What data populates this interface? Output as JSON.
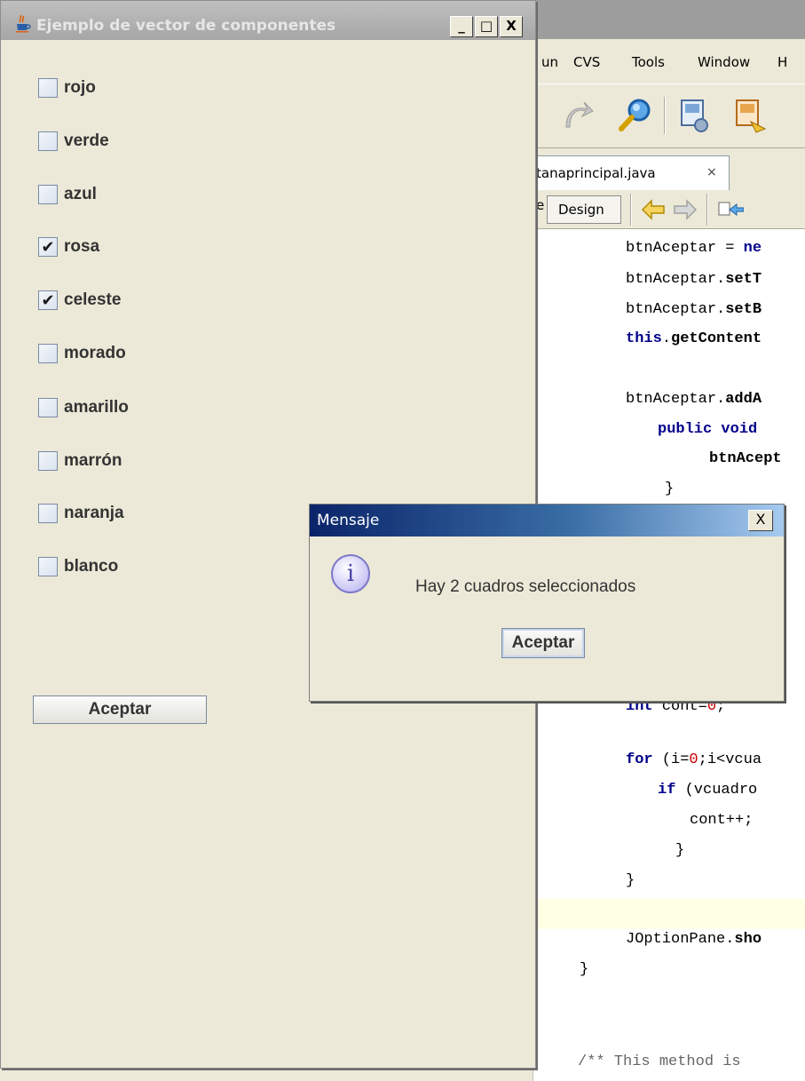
{
  "ide": {
    "menu": [
      "un",
      "CVS",
      "Tools",
      "Window",
      "H"
    ],
    "file_tab": {
      "label": "tanaprincipal.java",
      "close": "×"
    },
    "editor_bar": {
      "source_tail": "e",
      "design": "Design"
    },
    "code_bottom": "/** This method is"
  },
  "frame": {
    "title": "Ejemplo de vector de componentes",
    "minimize": "_",
    "maximize": "□",
    "close": "X",
    "checkboxes": [
      {
        "label": "rojo",
        "checked": false
      },
      {
        "label": "verde",
        "checked": false
      },
      {
        "label": "azul",
        "checked": false
      },
      {
        "label": "rosa",
        "checked": true
      },
      {
        "label": "celeste",
        "checked": true
      },
      {
        "label": "morado",
        "checked": false
      },
      {
        "label": "amarillo",
        "checked": false
      },
      {
        "label": "marrón",
        "checked": false
      },
      {
        "label": "naranja",
        "checked": false
      },
      {
        "label": "blanco",
        "checked": false
      }
    ],
    "button": "Aceptar",
    "check_mark": "✔"
  },
  "dialog": {
    "title": "Mensaje",
    "close": "X",
    "icon": "i",
    "message": "Hay 2 cuadros seleccionados",
    "button": "Aceptar"
  }
}
